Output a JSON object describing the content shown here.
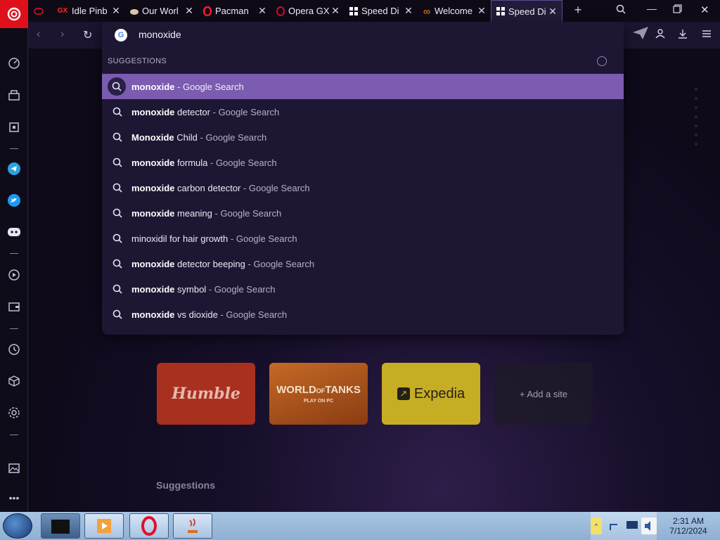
{
  "tabs": [
    {
      "title": "",
      "icon": "gx-controller-icon"
    },
    {
      "title": "Idle Pinb",
      "badge": "GX"
    },
    {
      "title": "Our Worl",
      "icon": "pet-icon"
    },
    {
      "title": "Pacman",
      "icon": "opera-icon"
    },
    {
      "title": "Opera GX",
      "icon": "opera-gx-icon"
    },
    {
      "title": "Speed Di",
      "icon": "speed-dial-icon"
    },
    {
      "title": "Welcome",
      "icon": "infinity-icon"
    },
    {
      "title": "Speed Di",
      "icon": "speed-dial-icon",
      "active": true
    }
  ],
  "address": {
    "value": "monoxide"
  },
  "suggestions_header": "SUGGESTIONS",
  "suggestions": [
    {
      "bold": "monoxide",
      "rest": "",
      "suffix": "- Google Search",
      "selected": true
    },
    {
      "bold": "monoxide",
      "rest": " detector",
      "suffix": "- Google Search"
    },
    {
      "bold": "Monoxide",
      "rest": " Child",
      "suffix": "- Google Search"
    },
    {
      "bold": "monoxide",
      "rest": " formula",
      "suffix": "- Google Search"
    },
    {
      "bold": "monoxide",
      "rest": " carbon detector",
      "suffix": "- Google Search"
    },
    {
      "bold": "monoxide",
      "rest": " meaning",
      "suffix": "- Google Search"
    },
    {
      "bold": "",
      "rest": "minoxidil for hair growth",
      "suffix": "- Google Search"
    },
    {
      "bold": "monoxide",
      "rest": " detector beeping",
      "suffix": "- Google Search"
    },
    {
      "bold": "monoxide",
      "rest": " symbol",
      "suffix": "- Google Search"
    },
    {
      "bold": "monoxide",
      "rest": " vs dioxide",
      "suffix": "- Google Search"
    }
  ],
  "speed_dial": {
    "humble": "Humble",
    "wot_line1": "WORLD",
    "wot_line1b": "OF",
    "wot_line1c": "TANKS",
    "wot_sub": "PLAY ON PC",
    "expedia": "Expedia",
    "add": "+ Add a site"
  },
  "suggestions_section_title": "Suggestions",
  "clock": {
    "time": "2:31 AM",
    "date": "7/12/2024"
  },
  "colors": {
    "accent": "#7b5cb0",
    "opera_red": "#e0101b"
  }
}
